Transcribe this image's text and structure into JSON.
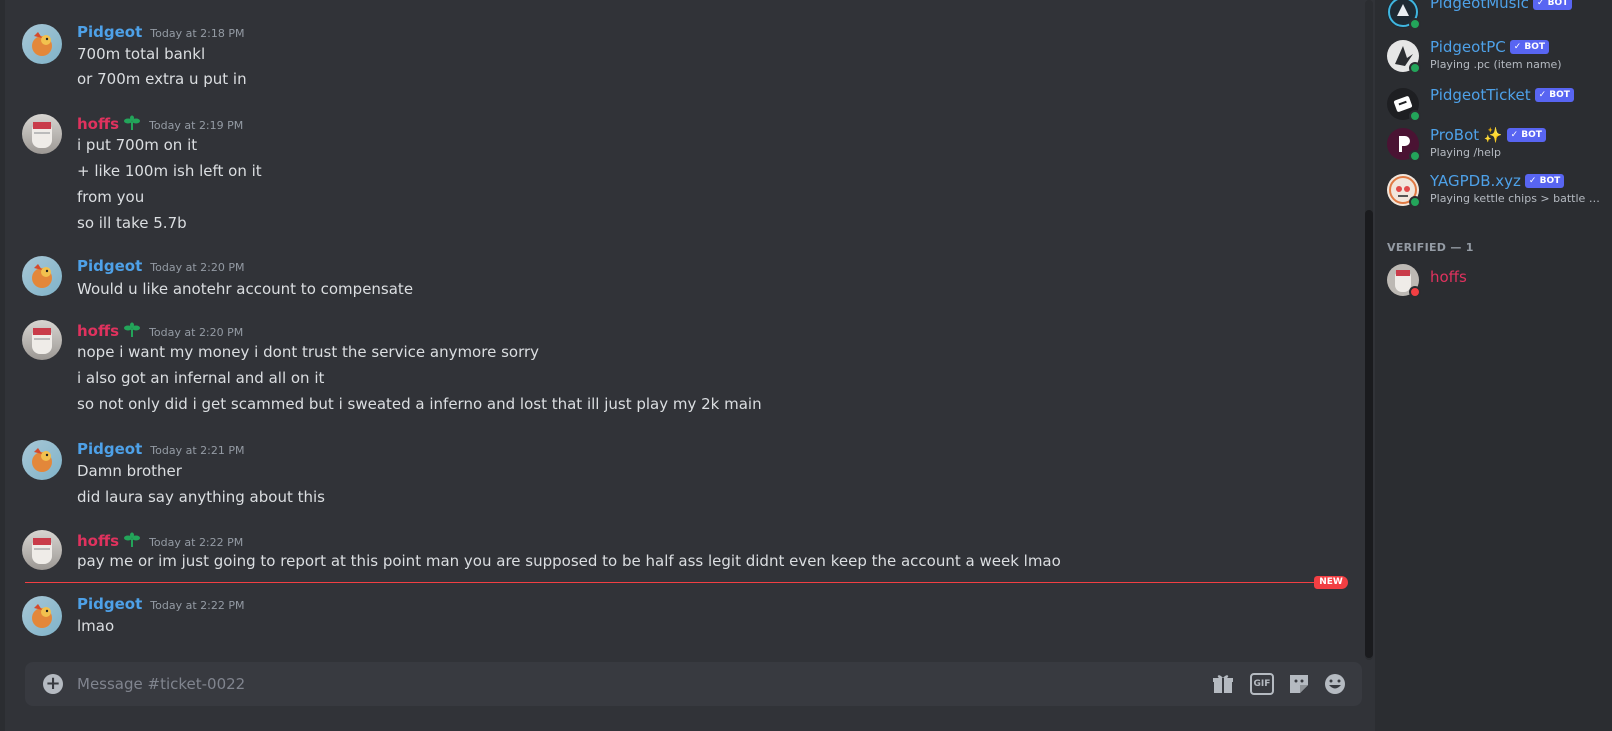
{
  "composer": {
    "placeholder": "Message #ticket-0022",
    "plus_glyph": "+",
    "gif_label": "GIF"
  },
  "new_divider_label": "NEW",
  "messages": [
    {
      "author": "Pidgeot",
      "timestamp": "Today at 2:18 PM",
      "lines": [
        "700m total bankl",
        "or 700m extra u put in"
      ]
    },
    {
      "author": "hoffs",
      "timestamp": "Today at 2:19 PM",
      "lines": [
        "i put 700m on it",
        "+ like 100m ish left on it",
        "from you",
        "so ill take 5.7b"
      ]
    },
    {
      "author": "Pidgeot",
      "timestamp": "Today at 2:20 PM",
      "lines": [
        "Would u like anotehr account to compensate"
      ]
    },
    {
      "author": "hoffs",
      "timestamp": "Today at 2:20 PM",
      "lines": [
        "nope i want my money i dont trust the service anymore sorry",
        "i also got an infernal and all on it",
        "so not only did i get scammed but i sweated a inferno and lost that ill just play my 2k main"
      ]
    },
    {
      "author": "Pidgeot",
      "timestamp": "Today at 2:21 PM",
      "lines": [
        "Damn brother",
        "did laura say anything about this"
      ]
    },
    {
      "author": "hoffs",
      "timestamp": "Today at 2:22 PM",
      "lines": [
        "pay me or im just going to report at this point man you are supposed to be half ass legit didnt even keep the account a week lmao"
      ]
    },
    {
      "author": "Pidgeot",
      "timestamp": "Today at 2:22 PM",
      "lines": [
        "lmao"
      ]
    }
  ],
  "members": {
    "bots": [
      {
        "name": "PidgeotMusic",
        "tag": "✓ BOT",
        "activity": ""
      },
      {
        "name": "PidgeotPC",
        "tag": "✓ BOT",
        "activity": "Playing .pc (item name)"
      },
      {
        "name": "PidgeotTicket",
        "tag": "✓ BOT",
        "activity": ""
      },
      {
        "name": "ProBot ✨",
        "tag": "✓ BOT",
        "activity": "Playing /help"
      },
      {
        "name": "YAGPDB.xyz",
        "tag": "✓ BOT",
        "activity": "Playing kettle chips > battle s..."
      }
    ],
    "verified_header": "VERIFIED — 1",
    "verified": [
      {
        "name": "hoffs"
      }
    ]
  },
  "colors": {
    "pidgeot_name": "#4ea1e8",
    "hoffs_name": "#e0325e",
    "new_divider": "#f23f43",
    "bot_tag": "#5865f2",
    "online": "#23a55a"
  },
  "icons": [
    "add-attachment-icon",
    "gift-icon",
    "gif-icon",
    "sticker-icon",
    "emoji-icon",
    "sprout-flair-icon"
  ]
}
